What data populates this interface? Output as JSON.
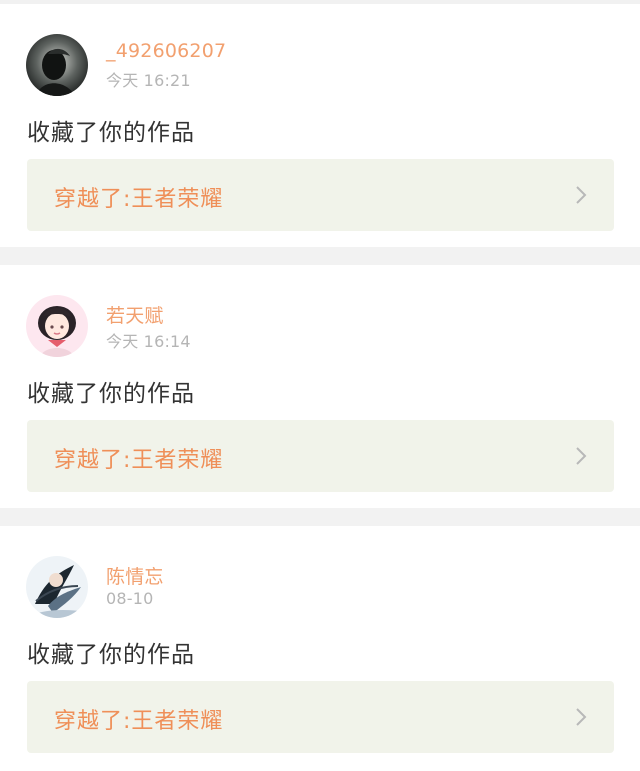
{
  "notifications": [
    {
      "username": "_492606207",
      "time": "今天 16:21",
      "action": "收藏了你的作品",
      "work_title": "穿越了:王者荣耀",
      "avatar": "dark-profile-avatar"
    },
    {
      "username": "若天赋",
      "time": "今天 16:14",
      "action": "收藏了你的作品",
      "work_title": "穿越了:王者荣耀",
      "avatar": "anime-girl-avatar"
    },
    {
      "username": "陈情忘",
      "time": "08-10",
      "action": "收藏了你的作品",
      "work_title": "穿越了:王者荣耀",
      "avatar": "ink-swordsman-avatar"
    }
  ],
  "colors": {
    "username": "#f2a06f",
    "time": "#b5b5b5",
    "action": "#333333",
    "work_title": "#ef8f58",
    "work_bg": "#f1f3ea",
    "separator": "#f2f2f2"
  },
  "icons": {
    "chevron": "chevron-right-icon"
  }
}
